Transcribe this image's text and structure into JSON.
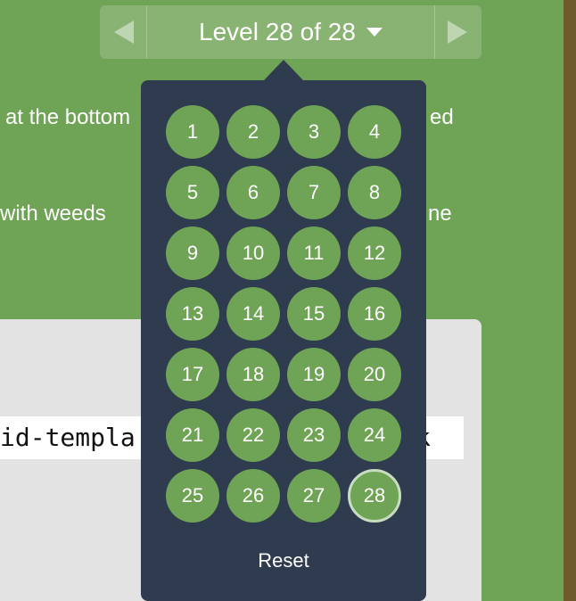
{
  "background_text": [
    "at the bottom",
    "ed",
    "with weeds",
    "ne"
  ],
  "code_editor": {
    "text_left": "id-templa",
    "text_right": "k"
  },
  "level_nav": {
    "prev_icon": "triangle-left-icon",
    "next_icon": "triangle-right-icon",
    "label": "Level 28 of 28",
    "caret_icon": "caret-down-icon"
  },
  "level_dropdown": {
    "levels": [
      "1",
      "2",
      "3",
      "4",
      "5",
      "6",
      "7",
      "8",
      "9",
      "10",
      "11",
      "12",
      "13",
      "14",
      "15",
      "16",
      "17",
      "18",
      "19",
      "20",
      "21",
      "22",
      "23",
      "24",
      "25",
      "26",
      "27",
      "28"
    ],
    "current_level": "28",
    "reset_label": "Reset"
  },
  "colors": {
    "background": "#6fa355",
    "panel": "#2f3b4e",
    "level_button": "#6fa355",
    "code_panel": "#e3e3e3",
    "right_edge": "#6f5b29"
  }
}
